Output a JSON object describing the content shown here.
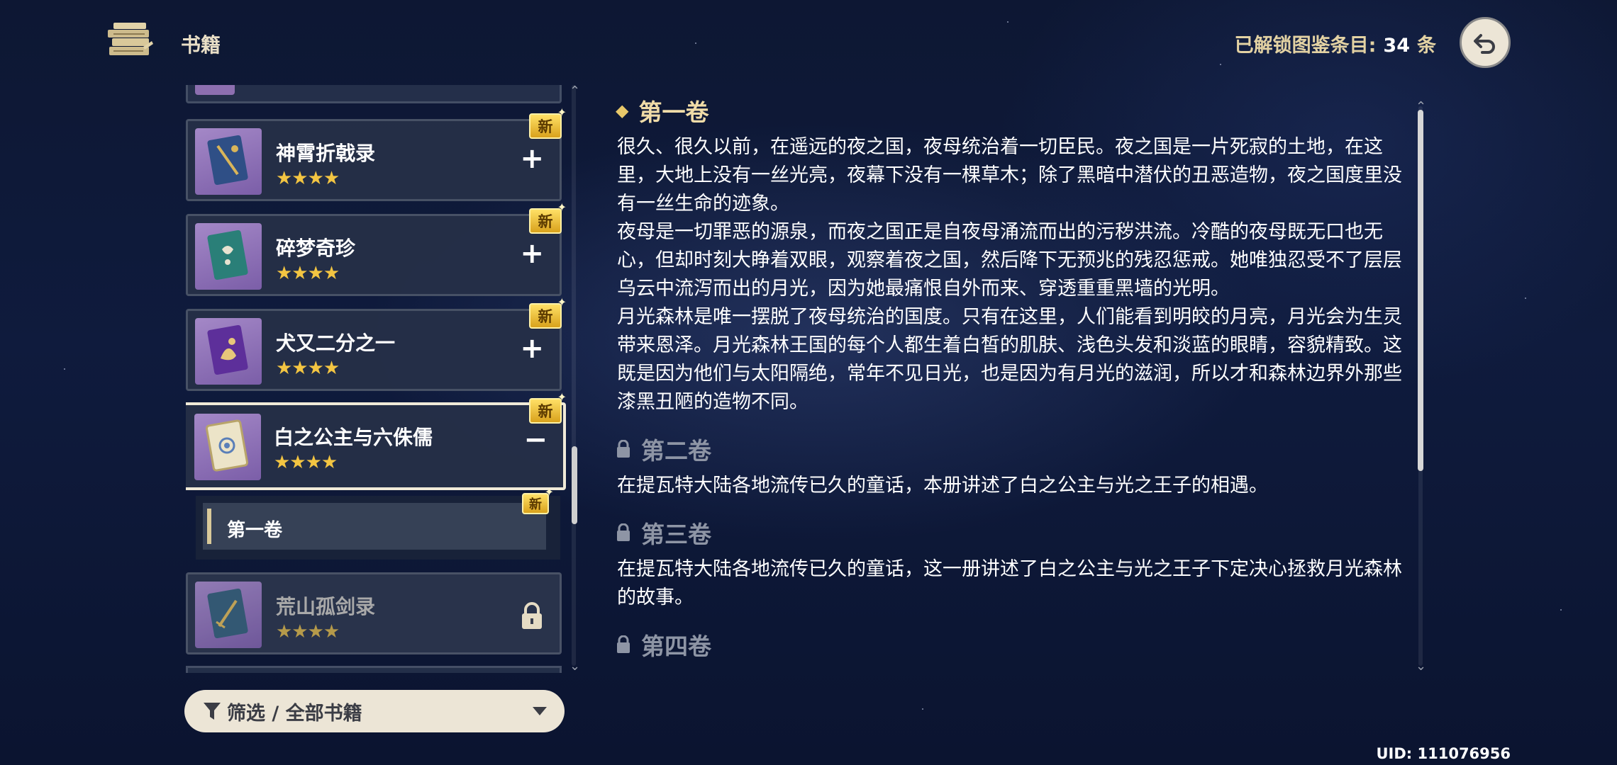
{
  "header": {
    "title": "书籍",
    "unlocked_label": "已解锁图鉴条目:",
    "unlocked_count": "34",
    "unlocked_unit": "条"
  },
  "books": [
    {
      "name": "神霄折戟录",
      "stars": "★★★★",
      "badge": "新",
      "action": "+",
      "cover_color": "#3f6aa8"
    },
    {
      "name": "碎梦奇珍",
      "stars": "★★★★",
      "badge": "新",
      "action": "+",
      "cover_color": "#2f8f86"
    },
    {
      "name": "犬又二分之一",
      "stars": "★★★★",
      "badge": "新",
      "action": "+",
      "cover_color": "#6a3fa8"
    },
    {
      "name": "白之公主与六侏儒",
      "stars": "★★★★",
      "badge": "新",
      "action": "−",
      "cover_color": "#e4dcc4"
    },
    {
      "name": "荒山孤剑录",
      "stars": "★★★★",
      "locked": true,
      "cover_color": "#3e6f8a"
    }
  ],
  "volume_list": [
    {
      "label": "第一卷",
      "badge": "新"
    }
  ],
  "filter": {
    "label": "筛选 / 全部书籍"
  },
  "content": {
    "vol1": {
      "title": "第一卷",
      "paragraphs": [
        "很久、很久以前，在遥远的夜之国，夜母统治着一切臣民。夜之国是一片死寂的土地，在这里，大地上没有一丝光亮，夜幕下没有一棵草木；除了黑暗中潜伏的丑恶造物，夜之国度里没有一丝生命的迹象。",
        "夜母是一切罪恶的源泉，而夜之国正是自夜母涌流而出的污秽洪流。冷酷的夜母既无口也无心，但却时刻大睁着双眼，观察着夜之国，然后降下无预兆的残忍惩戒。她唯独忍受不了层层乌云中流泻而出的月光，因为她最痛恨自外而来、穿透重重黑墙的光明。",
        "月光森林是唯一摆脱了夜母统治的国度。只有在这里，人们能看到明皎的月亮，月光会为生灵带来恩泽。月光森林王国的每个人都生着白皙的肌肤、浅色头发和淡蓝的眼睛，容貌精致。这既是因为他们与太阳隔绝，常年不见日光，也是因为有月光的滋润，所以才和森林边界外那些漆黑丑陋的造物不同。"
      ]
    },
    "vol2": {
      "title": "第二卷",
      "text": "在提瓦特大陆各地流传已久的童话，本册讲述了白之公主与光之王子的相遇。"
    },
    "vol3": {
      "title": "第三卷",
      "text": "在提瓦特大陆各地流传已久的童话，这一册讲述了白之公主与光之王子下定决心拯救月光森林的故事。"
    },
    "vol4": {
      "title": "第四卷"
    }
  },
  "uid": "UID: 111076956",
  "colors": {
    "gold": "#f3c542",
    "badge": "#e8b52c",
    "panel": "#26304a",
    "accent_text": "#f0dca8"
  }
}
